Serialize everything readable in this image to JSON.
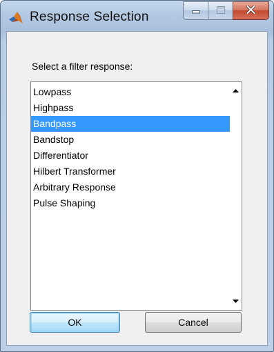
{
  "window": {
    "title": "Response Selection",
    "icon": "matlab-logo-icon"
  },
  "caption_buttons": {
    "minimize_icon": "minimize-icon",
    "maximize_icon": "maximize-icon",
    "close_icon": "close-icon"
  },
  "dialog": {
    "prompt": "Select a filter response:",
    "list": {
      "items": [
        {
          "label": "Lowpass",
          "selected": false
        },
        {
          "label": "Highpass",
          "selected": false
        },
        {
          "label": "Bandpass",
          "selected": true
        },
        {
          "label": "Bandstop",
          "selected": false
        },
        {
          "label": "Differentiator",
          "selected": false
        },
        {
          "label": "Hilbert Transformer",
          "selected": false
        },
        {
          "label": "Arbitrary Response",
          "selected": false
        },
        {
          "label": "Pulse Shaping",
          "selected": false
        }
      ],
      "scroll_up_icon": "scroll-up-arrow-icon",
      "scroll_down_icon": "scroll-down-arrow-icon"
    },
    "ok_label": "OK",
    "cancel_label": "Cancel"
  },
  "colors": {
    "selection": "#3399ff",
    "selection_text": "#ffffff",
    "dialog_background": "#f0f0f0",
    "close_button": "#c7553c"
  }
}
